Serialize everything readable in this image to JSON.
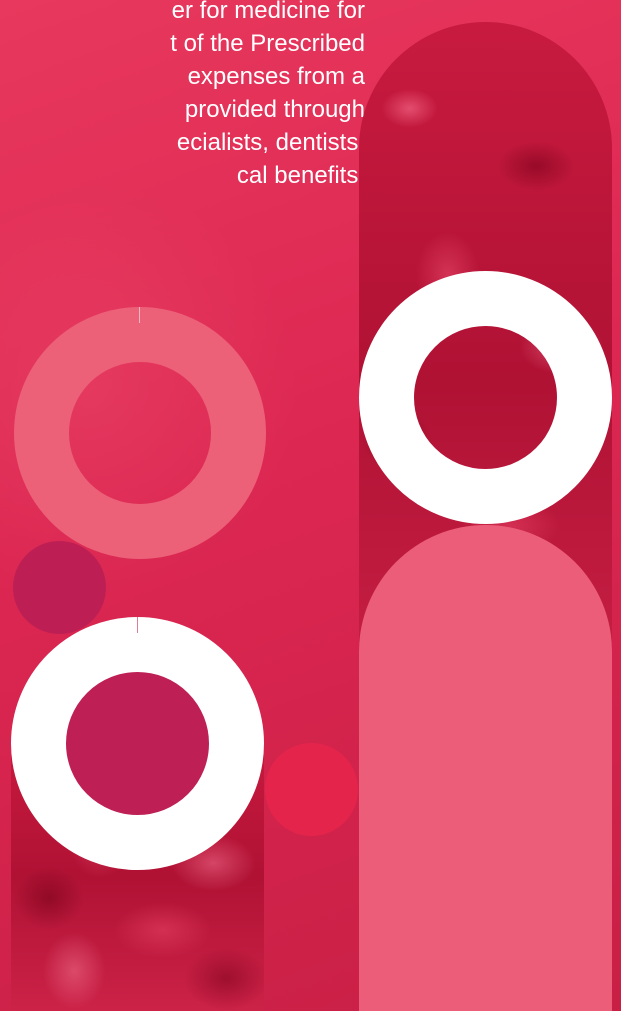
{
  "content": {
    "lines": [
      "er for medicine for",
      "t of the Prescribed",
      "expenses from a",
      "provided through",
      "ecialists, dentists,",
      "cal benefits."
    ]
  },
  "colors": {
    "background": "#dc2752",
    "text": "#ffffff",
    "ring_pink": "#ec6078",
    "ring_white": "#ffffff",
    "dot_magenta": "#bd1f55",
    "dot_red": "#e5244b",
    "pill_pink": "#eb5d78"
  }
}
